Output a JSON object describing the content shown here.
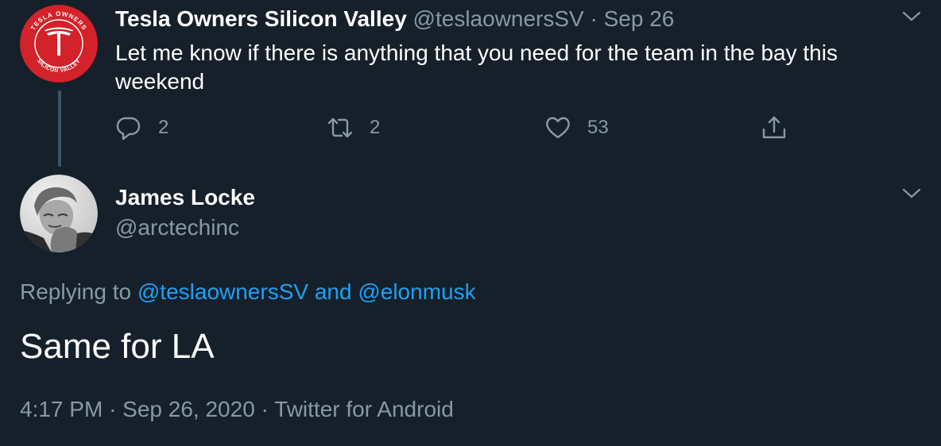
{
  "parent_tweet": {
    "author_name": "Tesla Owners Silicon Valley",
    "handle": "@teslaownersSV",
    "separator": "·",
    "date": "Sep 26",
    "text": "Let me know if there is anything that you need for the team in the bay this weekend",
    "avatar_logo_text_top": "TESLA OWNERS",
    "avatar_logo_text_bottom": "SILICON VALLEY",
    "actions": {
      "reply_count": "2",
      "retweet_count": "2",
      "like_count": "53"
    }
  },
  "reply_tweet": {
    "author_name": "James Locke",
    "handle": "@arctechinc",
    "replying_prefix": "Replying to",
    "replying_user1": "@teslaownersSV",
    "replying_and": "and",
    "replying_user2": "@elonmusk",
    "text": "Same for LA",
    "time": "4:17 PM",
    "date": "Sep 26, 2020",
    "source": "Twitter for Android",
    "separator": "·"
  },
  "icons": [
    "chevron-down-icon",
    "reply-icon",
    "retweet-icon",
    "like-icon",
    "share-icon"
  ],
  "colors": {
    "background": "#15202b",
    "text": "#ffffff",
    "secondary": "#8899a6",
    "link": "#1da1f2",
    "tesla_red": "#d3222a"
  }
}
